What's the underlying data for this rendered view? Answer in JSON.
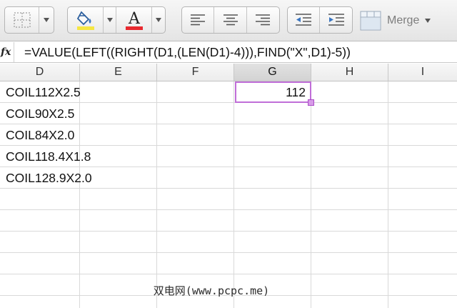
{
  "toolbar": {
    "items": [
      {
        "name": "borders-button"
      },
      {
        "name": "fill-color-button",
        "color": "#f5e642"
      },
      {
        "name": "font-color-button",
        "glyph": "A",
        "color": "#e8292f"
      },
      {
        "name": "align-left-button"
      },
      {
        "name": "align-center-button"
      },
      {
        "name": "align-right-button"
      },
      {
        "name": "decrease-indent-button"
      },
      {
        "name": "increase-indent-button"
      }
    ],
    "merge_label": "Merge"
  },
  "formula_bar": {
    "fx_label": "fx",
    "formula": "=VALUE(LEFT((RIGHT(D1,(LEN(D1)-4))),FIND(\"X\",D1)-5))"
  },
  "columns": [
    "D",
    "E",
    "F",
    "G",
    "H",
    "I"
  ],
  "selected_column": "G",
  "cells": {
    "D": [
      "COIL112X2.5",
      "COIL90X2.5",
      "COIL84X2.0",
      "COIL118.4X1.8",
      "COIL128.9X2.0"
    ],
    "G1": "112"
  },
  "colors": {
    "selection_border": "#c06ed8",
    "fill_bar": "#f5e642",
    "font_bar": "#e8292f"
  },
  "watermark": "双电网(www.pcpc.me)"
}
